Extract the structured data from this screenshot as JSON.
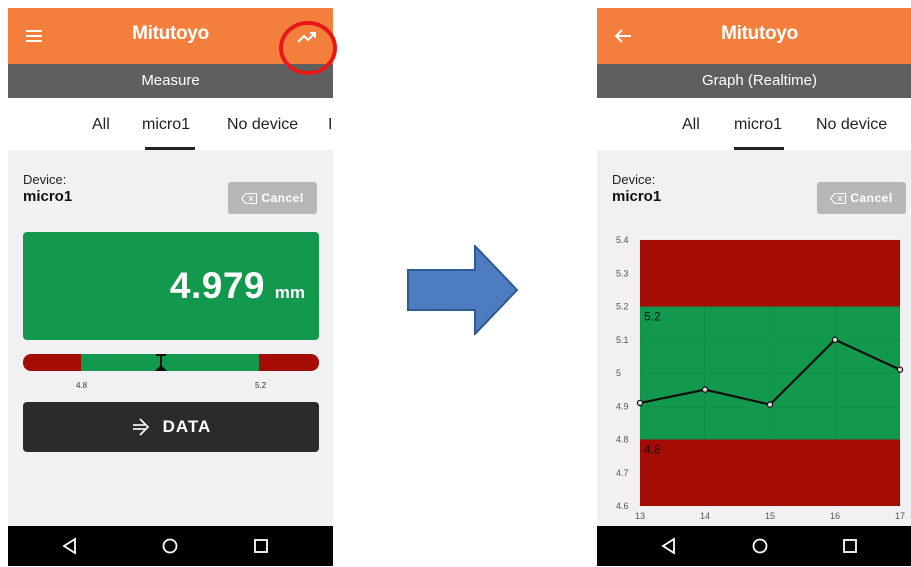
{
  "brand": "Mitutoyo",
  "left_screen": {
    "subtitle": "Measure",
    "tabs": [
      "All",
      "micro1",
      "No device",
      "I"
    ],
    "selected_tab": "micro1",
    "device_label": "Device:",
    "device_name": "micro1",
    "cancel_label": "Cancel",
    "reading_value": "4.979",
    "reading_unit": "mm",
    "tolerance_lower_label": "4.8",
    "tolerance_upper_label": "5.2",
    "data_button_label": "DATA"
  },
  "right_screen": {
    "subtitle": "Graph (Realtime)",
    "tabs": [
      "All",
      "micro1",
      "No device"
    ],
    "selected_tab": "micro1",
    "device_label": "Device:",
    "device_name": "micro1",
    "cancel_label": "Cancel"
  },
  "icons": {
    "menu": "menu-icon",
    "trend": "trending-up-icon",
    "back": "back-arrow-icon",
    "backspace": "backspace-icon",
    "data": "arrow-into-icon",
    "nav_back": "nav-back-icon",
    "nav_home": "nav-home-icon",
    "nav_recents": "nav-recents-icon",
    "transition": "right-arrow-icon"
  },
  "colors": {
    "appbar": "#f47f3c",
    "subbar": "#5f5f5f",
    "in_tolerance": "#12994d",
    "out_of_tolerance": "#a50c04",
    "highlight_circle": "#e8181a",
    "transition_arrow": "#4d7cc0"
  },
  "chart_data": {
    "type": "line",
    "x": [
      13,
      14,
      15,
      16,
      17
    ],
    "y": [
      4.91,
      4.95,
      4.905,
      5.1,
      5.01
    ],
    "xlim": [
      13,
      17
    ],
    "ylim": [
      4.6,
      5.4
    ],
    "yticks": [
      "4.6",
      "4.7",
      "4.8",
      "4.9",
      "5",
      "5.1",
      "5.2",
      "5.3",
      "5.4"
    ],
    "xticks": [
      "13",
      "14",
      "15",
      "16",
      "17"
    ],
    "bands": [
      {
        "from": 5.2,
        "to": 5.4,
        "color": "#a50c04"
      },
      {
        "from": 4.8,
        "to": 5.2,
        "color": "#12994d"
      },
      {
        "from": 4.6,
        "to": 4.8,
        "color": "#a50c04"
      }
    ],
    "annotations": [
      {
        "text": "5.2",
        "y": 5.2
      },
      {
        "text": "4.8",
        "y": 4.8
      }
    ],
    "grid": true
  }
}
